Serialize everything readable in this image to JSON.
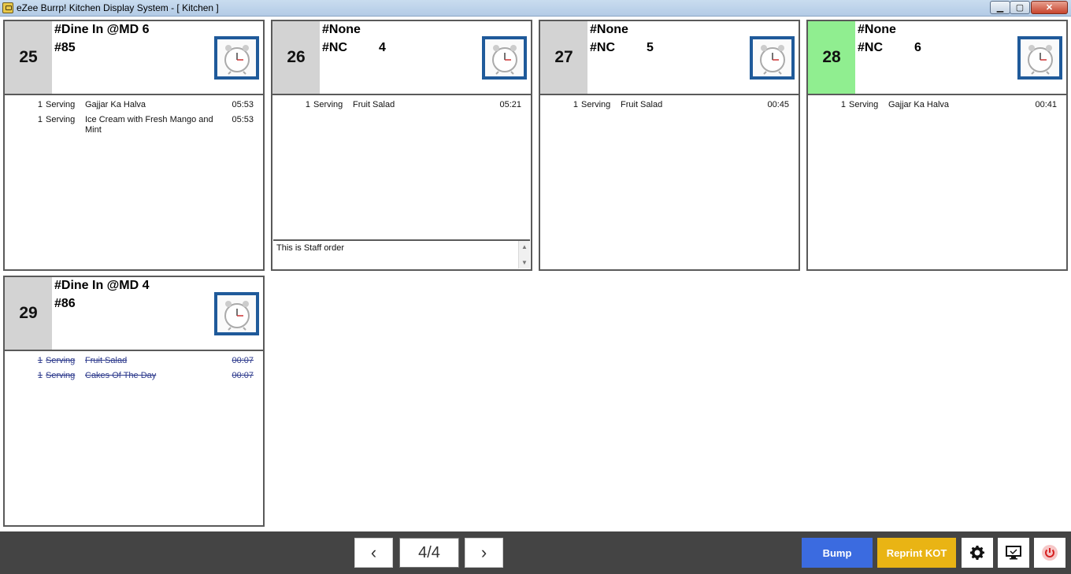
{
  "window": {
    "title": "eZee Burrp! Kitchen Display System - [ Kitchen ]",
    "min_glyph": "▁",
    "max_glyph": "▢",
    "close_glyph": "✕"
  },
  "orders": [
    {
      "token": "25",
      "title": "#Dine In @MD 6",
      "sub": "#85",
      "count": "",
      "token_color": "#d3d3d3",
      "items": [
        {
          "qty": "1",
          "unit": "Serving",
          "name": "Gajjar Ka Halva",
          "time": "05:53",
          "done": false
        },
        {
          "qty": "1",
          "unit": "Serving",
          "name": "Ice Cream with Fresh Mango and Mint",
          "time": "05:53",
          "done": false
        }
      ]
    },
    {
      "token": "26",
      "title": "#None",
      "sub": "#NC",
      "count": "4",
      "token_color": "#d3d3d3",
      "items": [
        {
          "qty": "1",
          "unit": "Serving",
          "name": "Fruit Salad",
          "time": "05:21",
          "done": false
        }
      ],
      "note": "This is Staff order"
    },
    {
      "token": "27",
      "title": "#None",
      "sub": "#NC",
      "count": "5",
      "token_color": "#d3d3d3",
      "items": [
        {
          "qty": "1",
          "unit": "Serving",
          "name": "Fruit Salad",
          "time": "00:45",
          "done": false
        }
      ]
    },
    {
      "token": "28",
      "title": "#None",
      "sub": "#NC",
      "count": "6",
      "token_color": "#90ee90",
      "items": [
        {
          "qty": "1",
          "unit": "Serving",
          "name": "Gajjar Ka Halva",
          "time": "00:41",
          "done": false
        }
      ]
    },
    {
      "token": "29",
      "title": "#Dine In @MD 4",
      "sub": "#86",
      "count": "",
      "token_color": "#d3d3d3",
      "items": [
        {
          "qty": "1",
          "unit": "Serving",
          "name": "Fruit Salad",
          "time": "00:07",
          "done": true
        },
        {
          "qty": "1",
          "unit": "Serving",
          "name": "Cakes Of The Day",
          "time": "00:07",
          "done": true
        }
      ]
    }
  ],
  "footer": {
    "prev_glyph": "‹",
    "next_glyph": "›",
    "page_indicator": "4/4",
    "bump_label": "Bump",
    "reprint_label": "Reprint KOT",
    "bump_color": "#3b6be0",
    "reprint_color": "#e9b414",
    "icons": [
      "gear-icon",
      "monitor-icon",
      "power-icon"
    ]
  }
}
